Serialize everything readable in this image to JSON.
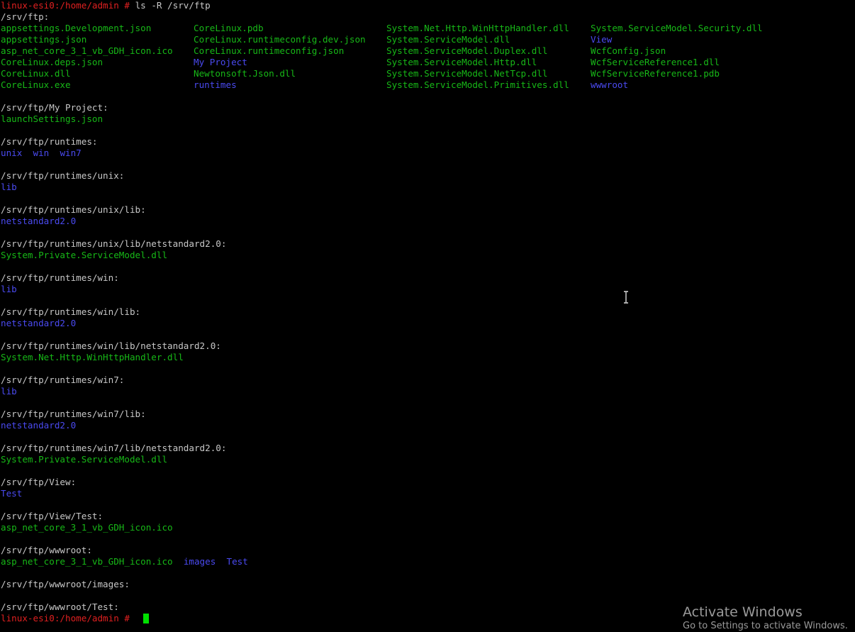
{
  "terminal": {
    "command_prompt": "linux-esi0:/home/admin",
    "command_hash": " #",
    "command": " ls -R /srv/ftp",
    "root_header": "/srv/ftp:",
    "root_grid": [
      [
        "appsettings.Development.json",
        "CoreLinux.pdb",
        "System.Net.Http.WinHttpHandler.dll",
        "System.ServiceModel.Security.dll"
      ],
      [
        "appsettings.json",
        "CoreLinux.runtimeconfig.dev.json",
        "System.ServiceModel.dll",
        "View"
      ],
      [
        "asp_net_core_3_1_vb_GDH_icon.ico",
        "CoreLinux.runtimeconfig.json",
        "System.ServiceModel.Duplex.dll",
        "WcfConfig.json"
      ],
      [
        "CoreLinux.deps.json",
        "My Project",
        "System.ServiceModel.Http.dll",
        "WcfServiceReference1.dll"
      ],
      [
        "CoreLinux.dll",
        "Newtonsoft.Json.dll",
        "System.ServiceModel.NetTcp.dll",
        "WcfServiceReference1.pdb"
      ],
      [
        "CoreLinux.exe",
        "runtimes",
        "System.ServiceModel.Primitives.dll",
        "wwwroot"
      ]
    ],
    "root_grid_types": [
      [
        "file",
        "file",
        "file",
        "file"
      ],
      [
        "file",
        "file",
        "file",
        "dir"
      ],
      [
        "file",
        "file",
        "file",
        "file"
      ],
      [
        "file",
        "dir",
        "file",
        "file"
      ],
      [
        "file",
        "file",
        "file",
        "file"
      ],
      [
        "file",
        "dir",
        "file",
        "dir"
      ]
    ],
    "sections": [
      {
        "header": "/srv/ftp/My Project:",
        "items": [
          {
            "name": "launchSettings.json",
            "type": "file"
          }
        ]
      },
      {
        "header": "/srv/ftp/runtimes:",
        "items": [
          {
            "name": "unix",
            "type": "dir"
          },
          {
            "name": "win",
            "type": "dir"
          },
          {
            "name": "win7",
            "type": "dir"
          }
        ]
      },
      {
        "header": "/srv/ftp/runtimes/unix:",
        "items": [
          {
            "name": "lib",
            "type": "dir"
          }
        ]
      },
      {
        "header": "/srv/ftp/runtimes/unix/lib:",
        "items": [
          {
            "name": "netstandard2.0",
            "type": "dir"
          }
        ]
      },
      {
        "header": "/srv/ftp/runtimes/unix/lib/netstandard2.0:",
        "items": [
          {
            "name": "System.Private.ServiceModel.dll",
            "type": "file"
          }
        ]
      },
      {
        "header": "/srv/ftp/runtimes/win:",
        "items": [
          {
            "name": "lib",
            "type": "dir"
          }
        ]
      },
      {
        "header": "/srv/ftp/runtimes/win/lib:",
        "items": [
          {
            "name": "netstandard2.0",
            "type": "dir"
          }
        ]
      },
      {
        "header": "/srv/ftp/runtimes/win/lib/netstandard2.0:",
        "items": [
          {
            "name": "System.Net.Http.WinHttpHandler.dll",
            "type": "file"
          }
        ]
      },
      {
        "header": "/srv/ftp/runtimes/win7:",
        "items": [
          {
            "name": "lib",
            "type": "dir"
          }
        ]
      },
      {
        "header": "/srv/ftp/runtimes/win7/lib:",
        "items": [
          {
            "name": "netstandard2.0",
            "type": "dir"
          }
        ]
      },
      {
        "header": "/srv/ftp/runtimes/win7/lib/netstandard2.0:",
        "items": [
          {
            "name": "System.Private.ServiceModel.dll",
            "type": "file"
          }
        ]
      },
      {
        "header": "/srv/ftp/View:",
        "items": [
          {
            "name": "Test",
            "type": "dir"
          }
        ]
      },
      {
        "header": "/srv/ftp/View/Test:",
        "items": [
          {
            "name": "asp_net_core_3_1_vb_GDH_icon.ico",
            "type": "file"
          }
        ]
      },
      {
        "header": "/srv/ftp/wwwroot:",
        "items": [
          {
            "name": "asp_net_core_3_1_vb_GDH_icon.ico",
            "type": "file"
          },
          {
            "name": "images",
            "type": "dir"
          },
          {
            "name": "Test",
            "type": "dir"
          }
        ]
      },
      {
        "header": "/srv/ftp/wwwroot/images:",
        "items": []
      },
      {
        "header": "/srv/ftp/wwwroot/Test:",
        "items": []
      }
    ],
    "final_prompt": "linux-esi0:/home/admin",
    "final_hash": " #",
    "colors": {
      "file": "#17b817",
      "dir": "#4a4af0",
      "text": "#c8c8c8",
      "prompt": "#e02020",
      "cursor": "#00e000",
      "background": "#000000"
    }
  },
  "watermark": {
    "title": "Activate Windows",
    "subtitle": "Go to Settings to activate Windows."
  },
  "icons": {
    "mouse_cursor": "text-ibeam-icon"
  }
}
